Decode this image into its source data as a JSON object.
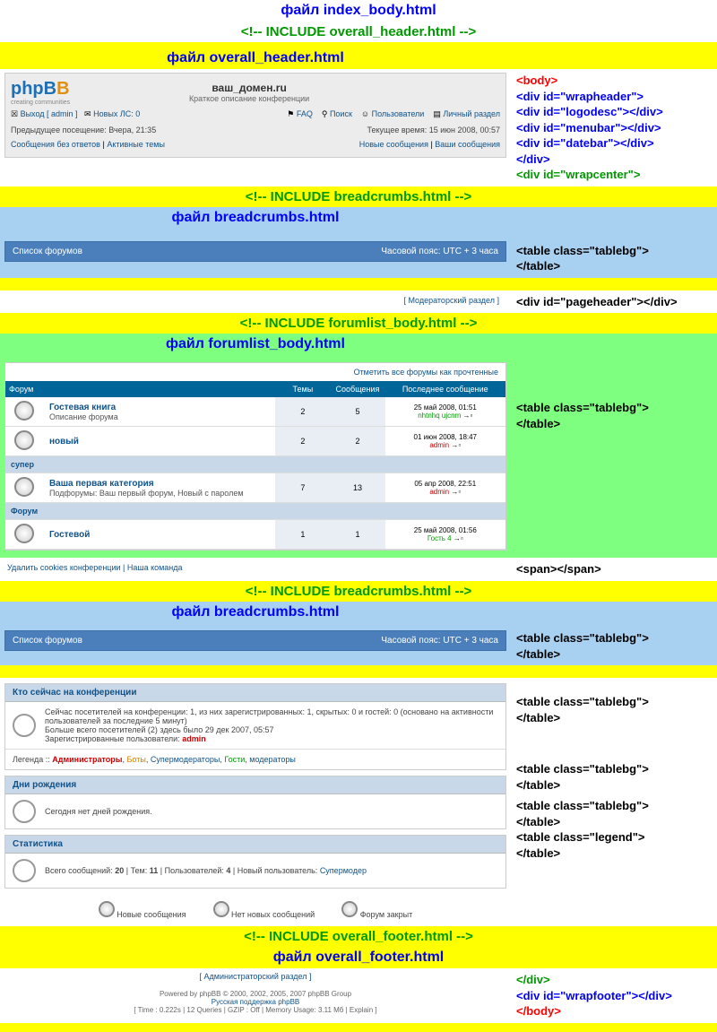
{
  "titles": {
    "index_body": "файл index_body.html",
    "inc_overall_header": "<!-- INCLUDE overall_header.html -->",
    "overall_header": "файл overall_header.html",
    "inc_breadcrumbs": "<!-- INCLUDE breadcrumbs.html -->",
    "breadcrumbs": "файл breadcrumbs.html",
    "inc_forumlist": "<!-- INCLUDE forumlist_body.html -->",
    "forumlist_body": "файл forumlist_body.html",
    "inc_overall_footer": "<!-- INCLUDE overall_footer.html -->",
    "overall_footer": "файл overall_footer.html"
  },
  "side": {
    "header_code": {
      "l1": "<body>",
      "l2": "<div id=\"wrapheader\">",
      "l3": "<div id=\"logodesc\"></div>",
      "l4": "<div id=\"menubar\"></div>",
      "l5": "<div id=\"datebar\"></div>",
      "l6": "</div>",
      "l7": "<div id=\"wrapcenter\">"
    },
    "tablebg_code": {
      "l1": "<table class=\"tablebg\">",
      "l2": "</table>"
    },
    "pageheader_code": "<div id=\"pageheader\"></div>",
    "span_code": "<span></span>",
    "legend_code": {
      "l1": "<table class=\"legend\">",
      "l2": "</table>"
    },
    "footer_code": {
      "l1": "</div>",
      "l2": "<div id=\"wrapfooter\"></div>",
      "l3": "</body>"
    }
  },
  "header": {
    "site_name": "ваш_домен.ru",
    "site_desc": "Краткое описание конференции",
    "logo_main": "php",
    "logo_mid": "B",
    "logo_tail": "B",
    "logo_sub": "creating communities",
    "menu": {
      "logout": "Выход [ admin ]",
      "pm": "Новых ЛС: 0",
      "faq": "FAQ",
      "search": "Поиск",
      "members": "Пользователи",
      "ucp": "Личный раздел"
    },
    "datebar": {
      "visit": "Предыдущее посещение: Вчера, 21:35",
      "now": "Текущее время: 15 июн 2008, 00:57"
    },
    "msgbar": {
      "left1": "Сообщения без ответов",
      "left2": "Активные темы",
      "right1": "Новые сообщения",
      "right2": "Ваши сообщения"
    }
  },
  "breadcrumbs": {
    "left": "Список форумов",
    "right": "Часовой пояс: UTC + 3 часа"
  },
  "modlink": "[ Модераторский раздел ]",
  "marklink": "Отметить все форумы как прочтенные",
  "ftable_head": {
    "forum": "Форум",
    "topics": "Темы",
    "posts": "Сообщения",
    "last": "Последнее сообщение"
  },
  "cat1": "",
  "rows": [
    {
      "cat": "",
      "name": "Гостевая книга",
      "desc": "Описание форума",
      "t": "2",
      "p": "5",
      "date": "25 май 2008, 01:51",
      "who": "nhtnhq ujcnm",
      "cls": "who-g"
    },
    {
      "name": "новый",
      "desc": "",
      "t": "2",
      "p": "2",
      "date": "01 июн 2008, 18:47",
      "who": "admin",
      "cls": "who-r"
    }
  ],
  "cat2": "супер",
  "row3": {
    "name": "Ваша первая категория",
    "desc": "Подфорумы: Ваш первый форум, Новый с паролем",
    "t": "7",
    "p": "13",
    "date": "05 апр 2008, 22:51",
    "who": "admin",
    "cls": "who-r"
  },
  "cat3": "Форум",
  "row4": {
    "name": "Гостевой",
    "desc": "",
    "t": "1",
    "p": "1",
    "date": "25 май 2008, 01:56",
    "who": "Гость 4",
    "cls": "who-g"
  },
  "spanlinks": {
    "l1": "Удалить cookies конференции",
    "l2": "Наша команда"
  },
  "online": {
    "head": "Кто сейчас на конференции",
    "body1": "Сейчас посетителей на конференции: 1, из них зарегистрированных: 1, скрытых: 0 и гостей: 0 (основано на активности пользователей за последние 5 минут)",
    "body2": "Больше всего посетителей (2) здесь было 29 дек 2007, 05:57",
    "body3a": "Зарегистрированные пользователи: ",
    "body3b": "admin",
    "legend_a": "Легенда :: ",
    "leg1": "Администраторы",
    "leg2": "Боты",
    "leg3": "Супермодераторы",
    "leg4": "Гости",
    "leg5": "модераторы"
  },
  "bday": {
    "head": "Дни рождения",
    "body": "Сегодня нет дней рождения."
  },
  "stats": {
    "head": "Статистика",
    "body_a": "Всего сообщений: ",
    "v1": "20",
    "sep": " | ",
    "body_b": "Тем: ",
    "v2": "11",
    "body_c": "Пользователей: ",
    "v3": "4",
    "body_d": "Новый пользователь: ",
    "user": "Супермодер"
  },
  "legend_icons": {
    "l1": "Новые сообщения",
    "l2": "Нет новых сообщений",
    "l3": "Форум закрыт"
  },
  "footer": {
    "adminlink": "[ Администраторский раздел ]",
    "l1": "Powered by phpBB © 2000, 2002, 2005, 2007 phpBB Group",
    "l2": "Русская поддержка phpBB",
    "l3": "[ Time : 0.222s | 12 Queries | GZIP : Off | Memory Usage: 3.11 Мб | Explain ]"
  }
}
